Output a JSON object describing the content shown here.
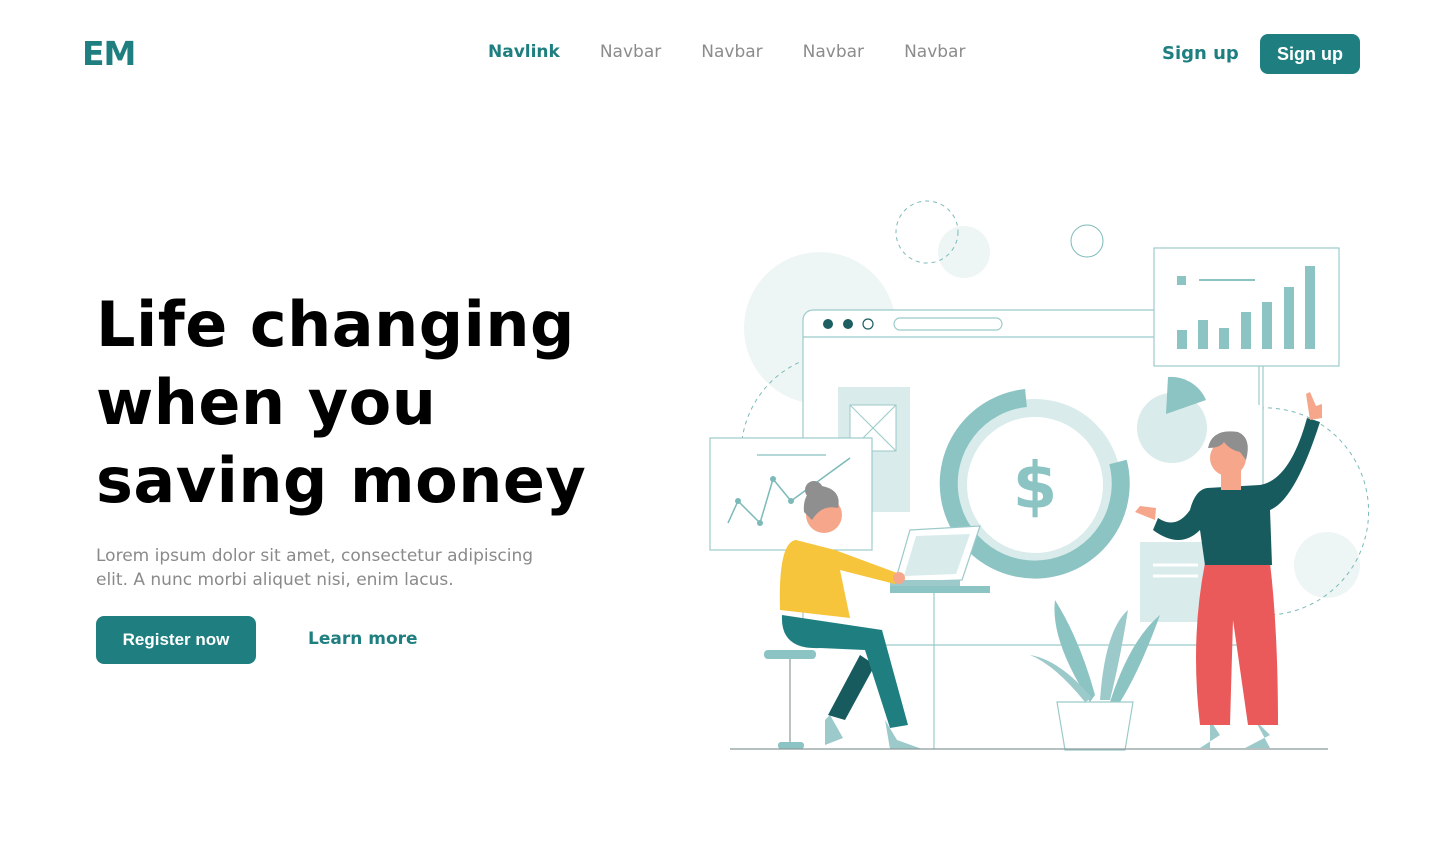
{
  "brand": {
    "logo": "EM",
    "accent_color": "#1f7f80"
  },
  "nav": {
    "items": [
      {
        "label": "Navlink",
        "active": true
      },
      {
        "label": "Navbar",
        "active": false
      },
      {
        "label": "Navbar",
        "active": false
      },
      {
        "label": "Navbar",
        "active": false
      },
      {
        "label": "Navbar",
        "active": false
      }
    ]
  },
  "header": {
    "signup_link": "Sign up",
    "signup_button": "Sign up"
  },
  "hero": {
    "title": "Life changing when you saving money",
    "description": "Lorem ipsum dolor sit amet, consectetur adipiscing elit. A nunc morbi aliquet nisi, enim lacus.",
    "primary_cta": "Register now",
    "secondary_cta": "Learn more"
  },
  "illustration": {
    "currency_symbol": "$"
  }
}
